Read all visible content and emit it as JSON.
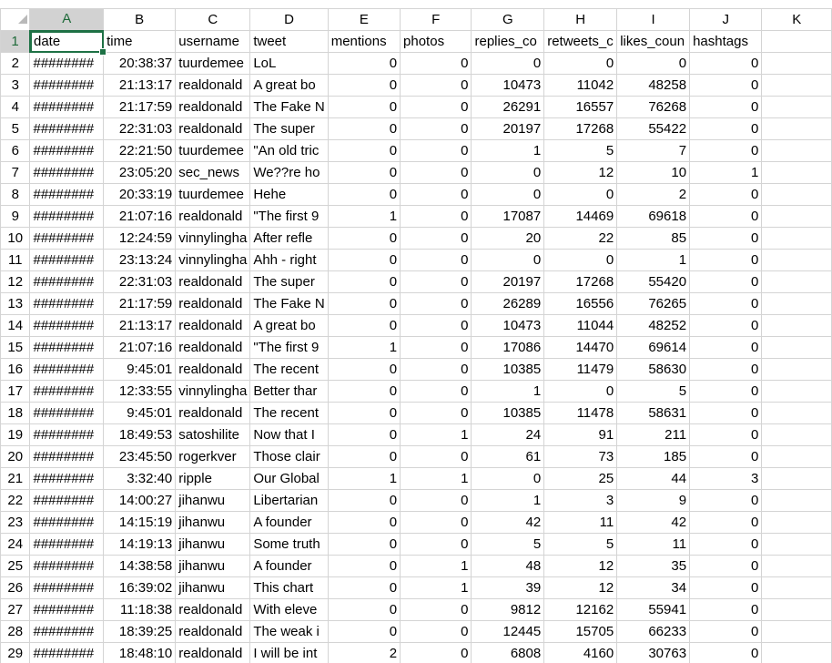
{
  "sheet": {
    "columns": [
      "A",
      "B",
      "C",
      "D",
      "E",
      "F",
      "G",
      "H",
      "I",
      "J",
      "K"
    ],
    "selected_column": "A",
    "selected_row": "1",
    "active_cell": "A1"
  },
  "table": {
    "headers": [
      "date",
      "time",
      "username",
      "tweet",
      "mentions",
      "photos",
      "replies_co",
      "retweets_c",
      "likes_coun",
      "hashtags",
      ""
    ],
    "rows": [
      {
        "n": "2",
        "cells": [
          "########",
          "20:38:37",
          "tuurdemee",
          "LoL",
          "0",
          "0",
          "0",
          "0",
          "0",
          "0",
          ""
        ]
      },
      {
        "n": "3",
        "cells": [
          "########",
          "21:13:17",
          "realdonald",
          "A great bo",
          "0",
          "0",
          "10473",
          "11042",
          "48258",
          "0",
          ""
        ]
      },
      {
        "n": "4",
        "cells": [
          "########",
          "21:17:59",
          "realdonald",
          "The Fake N",
          "0",
          "0",
          "26291",
          "16557",
          "76268",
          "0",
          ""
        ]
      },
      {
        "n": "5",
        "cells": [
          "########",
          "22:31:03",
          "realdonald",
          "The super",
          "0",
          "0",
          "20197",
          "17268",
          "55422",
          "0",
          ""
        ]
      },
      {
        "n": "6",
        "cells": [
          "########",
          "22:21:50",
          "tuurdemee",
          "\"An old tric",
          "0",
          "0",
          "1",
          "5",
          "7",
          "0",
          ""
        ]
      },
      {
        "n": "7",
        "cells": [
          "########",
          "23:05:20",
          "sec_news",
          "We??re ho",
          "0",
          "0",
          "0",
          "12",
          "10",
          "1",
          ""
        ]
      },
      {
        "n": "8",
        "cells": [
          "########",
          "20:33:19",
          "tuurdemee",
          "Hehe",
          "0",
          "0",
          "0",
          "0",
          "2",
          "0",
          ""
        ]
      },
      {
        "n": "9",
        "cells": [
          "########",
          "21:07:16",
          "realdonald",
          "\"The first 9",
          "1",
          "0",
          "17087",
          "14469",
          "69618",
          "0",
          ""
        ]
      },
      {
        "n": "10",
        "cells": [
          "########",
          "12:24:59",
          "vinnylingha",
          "After refle",
          "0",
          "0",
          "20",
          "22",
          "85",
          "0",
          ""
        ]
      },
      {
        "n": "11",
        "cells": [
          "########",
          "23:13:24",
          "vinnylingha",
          "Ahh - right",
          "0",
          "0",
          "0",
          "0",
          "1",
          "0",
          ""
        ]
      },
      {
        "n": "12",
        "cells": [
          "########",
          "22:31:03",
          "realdonald",
          "The super",
          "0",
          "0",
          "20197",
          "17268",
          "55420",
          "0",
          ""
        ]
      },
      {
        "n": "13",
        "cells": [
          "########",
          "21:17:59",
          "realdonald",
          "The Fake N",
          "0",
          "0",
          "26289",
          "16556",
          "76265",
          "0",
          ""
        ]
      },
      {
        "n": "14",
        "cells": [
          "########",
          "21:13:17",
          "realdonald",
          "A great bo",
          "0",
          "0",
          "10473",
          "11044",
          "48252",
          "0",
          ""
        ]
      },
      {
        "n": "15",
        "cells": [
          "########",
          "21:07:16",
          "realdonald",
          "\"The first 9",
          "1",
          "0",
          "17086",
          "14470",
          "69614",
          "0",
          ""
        ]
      },
      {
        "n": "16",
        "cells": [
          "########",
          "9:45:01",
          "realdonald",
          "The recent",
          "0",
          "0",
          "10385",
          "11479",
          "58630",
          "0",
          ""
        ]
      },
      {
        "n": "17",
        "cells": [
          "########",
          "12:33:55",
          "vinnylingha",
          "Better thar",
          "0",
          "0",
          "1",
          "0",
          "5",
          "0",
          ""
        ]
      },
      {
        "n": "18",
        "cells": [
          "########",
          "9:45:01",
          "realdonald",
          "The recent",
          "0",
          "0",
          "10385",
          "11478",
          "58631",
          "0",
          ""
        ]
      },
      {
        "n": "19",
        "cells": [
          "########",
          "18:49:53",
          "satoshilite",
          "Now that I",
          "0",
          "1",
          "24",
          "91",
          "211",
          "0",
          ""
        ]
      },
      {
        "n": "20",
        "cells": [
          "########",
          "23:45:50",
          "rogerkver",
          "Those clair",
          "0",
          "0",
          "61",
          "73",
          "185",
          "0",
          ""
        ]
      },
      {
        "n": "21",
        "cells": [
          "########",
          "3:32:40",
          "ripple",
          "Our Global",
          "1",
          "1",
          "0",
          "25",
          "44",
          "3",
          ""
        ]
      },
      {
        "n": "22",
        "cells": [
          "########",
          "14:00:27",
          "jihanwu",
          "Libertarian",
          "0",
          "0",
          "1",
          "3",
          "9",
          "0",
          ""
        ]
      },
      {
        "n": "23",
        "cells": [
          "########",
          "14:15:19",
          "jihanwu",
          "A founder",
          "0",
          "0",
          "42",
          "11",
          "42",
          "0",
          ""
        ]
      },
      {
        "n": "24",
        "cells": [
          "########",
          "14:19:13",
          "jihanwu",
          "Some truth",
          "0",
          "0",
          "5",
          "5",
          "11",
          "0",
          ""
        ]
      },
      {
        "n": "25",
        "cells": [
          "########",
          "14:38:58",
          "jihanwu",
          "A founder",
          "0",
          "1",
          "48",
          "12",
          "35",
          "0",
          ""
        ]
      },
      {
        "n": "26",
        "cells": [
          "########",
          "16:39:02",
          "jihanwu",
          "This chart",
          "0",
          "1",
          "39",
          "12",
          "34",
          "0",
          ""
        ]
      },
      {
        "n": "27",
        "cells": [
          "########",
          "11:18:38",
          "realdonald",
          "With eleve",
          "0",
          "0",
          "9812",
          "12162",
          "55941",
          "0",
          ""
        ]
      },
      {
        "n": "28",
        "cells": [
          "########",
          "18:39:25",
          "realdonald",
          "The weak i",
          "0",
          "0",
          "12445",
          "15705",
          "66233",
          "0",
          ""
        ]
      },
      {
        "n": "29",
        "cells": [
          "########",
          "18:48:10",
          "realdonald",
          "I will be int",
          "2",
          "0",
          "6808",
          "4160",
          "30763",
          "0",
          ""
        ]
      }
    ]
  },
  "colors": {
    "selection_accent": "#1e7145",
    "header_selected_bg": "#d2d2d2",
    "gridline": "#d4d4d4"
  }
}
